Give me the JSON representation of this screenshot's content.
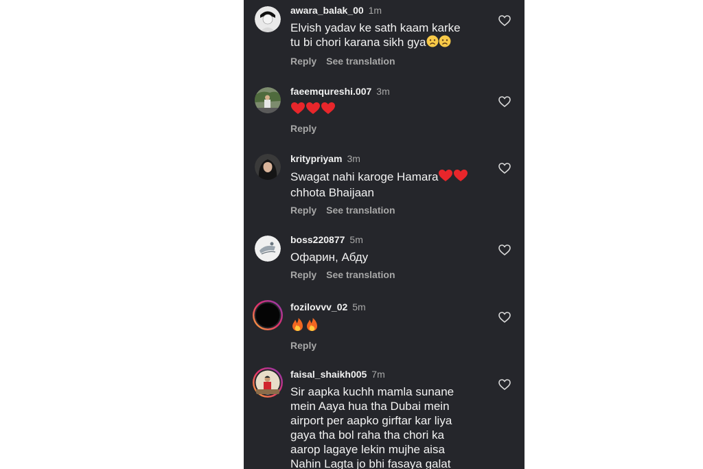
{
  "comments": [
    {
      "username": "awara_balak_00",
      "time": "1m",
      "text_lines": [
        "Elvish yadav ke sath kaam karke",
        "tu bi chori karana sikh gya"
      ],
      "emoji_after": [
        "sad-face",
        "sad-face"
      ],
      "reply": "Reply",
      "translate": "See translation"
    },
    {
      "username": "faeemqureshi.007",
      "time": "3m",
      "emoji_only": [
        "red-heart",
        "red-heart",
        "red-heart"
      ],
      "reply": "Reply"
    },
    {
      "username": "kritypriyam",
      "time": "3m",
      "text_lines": [
        "Swagat nahi karoge Hamara",
        "chhota Bhaijaan"
      ],
      "line1_emoji": [
        "red-heart",
        "red-heart"
      ],
      "reply": "Reply",
      "translate": "See translation"
    },
    {
      "username": "boss220877",
      "time": "5m",
      "text_lines": [
        "Офарин, Абду"
      ],
      "reply": "Reply",
      "translate": "See translation"
    },
    {
      "username": "fozilovvv_02",
      "time": "5m",
      "emoji_only": [
        "fire",
        "fire"
      ],
      "reply": "Reply"
    },
    {
      "username": "faisal_shaikh005",
      "time": "7m",
      "text_lines": [
        "Sir aapka kuchh mamla sunane",
        "mein Aaya hua tha Dubai mein",
        "airport per aapko girftar kar liya",
        "gaya tha bol raha tha chori ka",
        "aarop lagaye lekin mujhe aisa",
        "Nahin Lagta jo bhi fasaya galat"
      ]
    }
  ],
  "colors": {
    "background": "#25262b",
    "text": "#f2f2f2",
    "muted": "#a8a8a8",
    "story_ring": "#c13584"
  },
  "icons": {
    "like": "heart-outline-icon"
  }
}
